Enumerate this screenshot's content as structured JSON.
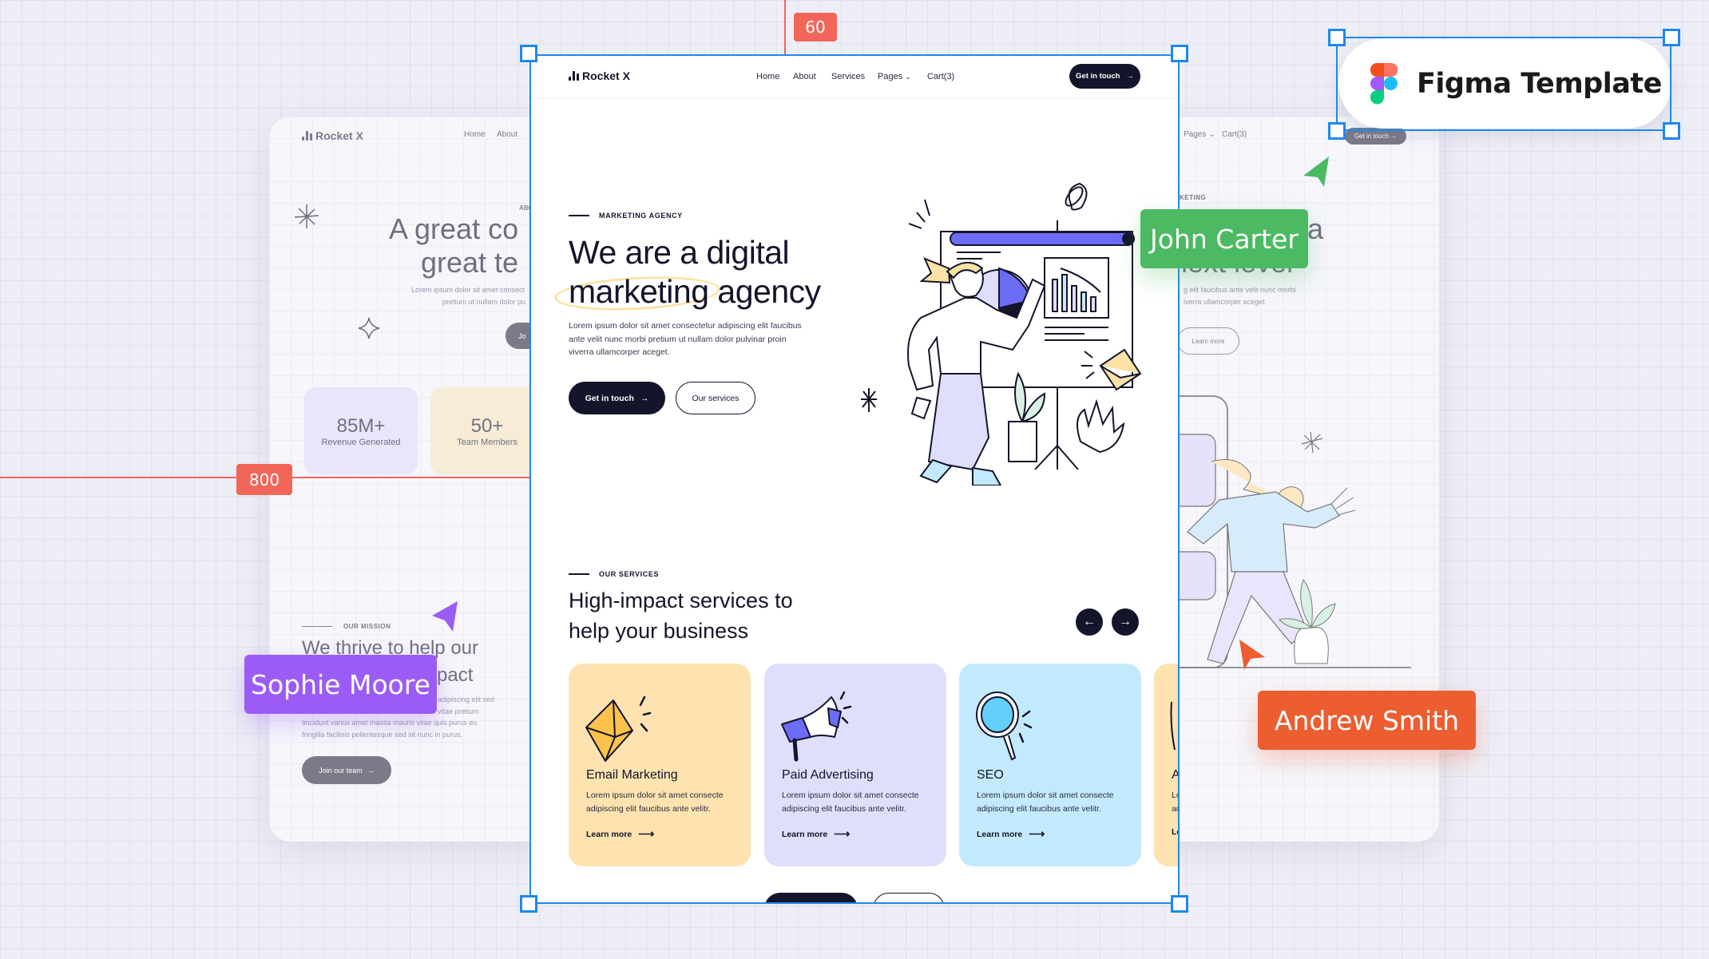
{
  "guides": {
    "top_value": "60",
    "left_value": "800",
    "color": "#f2665a"
  },
  "badge": {
    "label": "Figma Template",
    "icon": "figma-logo"
  },
  "cursors": [
    {
      "name": "John Carter",
      "color": "#4cb963"
    },
    {
      "name": "Sophie Moore",
      "color": "#9b5cf6"
    },
    {
      "name": "Andrew Smith",
      "color": "#ec5d30"
    }
  ],
  "background_page": {
    "logo": "Rocket X",
    "nav": [
      "Home",
      "About"
    ],
    "nav_right": [
      "Pages",
      "Cart(3)"
    ],
    "cta": "Get in touch →",
    "about_eyebrow": "ABO",
    "about_title": [
      "A great co",
      "great te"
    ],
    "about_text": [
      "Lorem ipsum dolor sit amet consect",
      "pretium ut nullam dolor pu"
    ],
    "about_button": "Jo",
    "stats": [
      {
        "value": "85M+",
        "label": "Revenue Generated"
      },
      {
        "value": "50+",
        "label": "Team Members"
      }
    ],
    "mission_eyebrow": "OUR MISSION",
    "mission_title": [
      "We thrive to help our",
      "pact"
    ],
    "mission_text": [
      "adipiscing elit sed",
      "vitae pretium",
      "tincidunt varius amet massa mauris vitae quis purus eu",
      "fringilla facilisis pellentesque sed sit nunc in purus."
    ],
    "mission_button": "Join our team",
    "right_eyebrow": "KETING",
    "right_title": [
      "a",
      "o next level"
    ],
    "right_text": [
      "g elit faucibus ante velit nunc morbi",
      "iverra ullamcorper aceget."
    ],
    "right_button": "Learn more"
  },
  "main": {
    "nav": {
      "logo": "Rocket X",
      "links": [
        "Home",
        "About",
        "Services",
        "Pages",
        "Cart(3)"
      ],
      "cta": "Get in touch"
    },
    "hero": {
      "eyebrow": "MARKETING AGENCY",
      "title_line1": "We are a digital",
      "title_highlight": "marketing",
      "title_rest": " agency",
      "paragraph": [
        "Lorem ipsum dolor sit amet consectetur adipiscing elit faucibus",
        "ante velit nunc morbi pretium ut nullam dolor pulvinar proin",
        "viverra ullamcorper aceget."
      ],
      "primary_button": "Get in touch",
      "secondary_button": "Our services"
    },
    "services": {
      "eyebrow": "OUR SERVICES",
      "title": [
        "High-impact services to",
        "help your business"
      ],
      "cards": [
        {
          "title": "Email Marketing",
          "text": [
            "Lorem ipsum dolor sit amet consecte",
            "adipiscing elit faucibus ante velitr."
          ],
          "link": "Learn more",
          "icon": "envelope",
          "color": "#fee3b0"
        },
        {
          "title": "Paid Advertising",
          "text": [
            "Lorem ipsum dolor sit amet consecte",
            "adipiscing elit faucibus ante velitr."
          ],
          "link": "Learn more",
          "icon": "megaphone",
          "color": "#e0defd"
        },
        {
          "title": "SEO",
          "text": [
            "Lorem ipsum dolor sit amet consecte",
            "adipiscing elit faucibus ante velitr."
          ],
          "link": "Learn more",
          "icon": "magnifier",
          "color": "#c3eafc"
        },
        {
          "title": "A",
          "text": [
            "Lo",
            "ad"
          ],
          "link": "Le",
          "icon": "unknown",
          "color": "#fee3b0"
        }
      ]
    }
  }
}
